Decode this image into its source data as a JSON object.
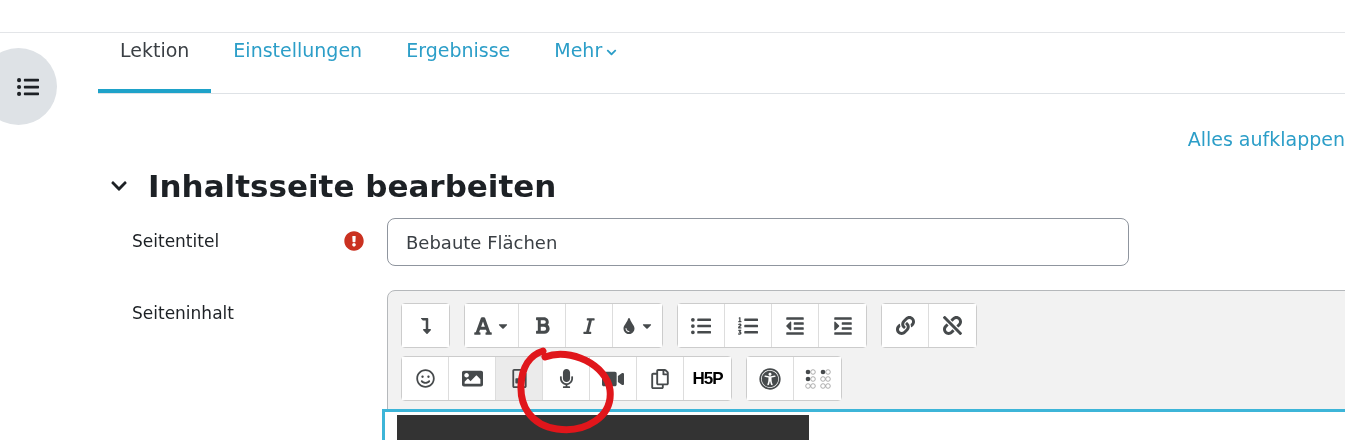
{
  "tabs": [
    {
      "label": "Lektion",
      "selected": true
    },
    {
      "label": "Einstellungen",
      "selected": false
    },
    {
      "label": "Ergebnisse",
      "selected": false
    },
    {
      "label": "Mehr",
      "selected": false,
      "dropdown": true
    }
  ],
  "expand_all": "Alles aufklappen",
  "section": {
    "title": "Inhaltsseite bearbeiten",
    "expanded": true
  },
  "fields": [
    {
      "label": "Seitentitel",
      "required": true,
      "value": "Bebaute Flächen"
    },
    {
      "label": "Seiteninhalt",
      "required": false
    }
  ],
  "toolbar_rows": [
    [
      [
        {
          "kind": "collapse",
          "selected": false
        }
      ],
      [
        {
          "kind": "font",
          "selected": false
        },
        {
          "kind": "bold",
          "selected": false
        },
        {
          "kind": "italic",
          "selected": false
        },
        {
          "kind": "color",
          "selected": false
        }
      ],
      [
        {
          "kind": "bullets",
          "selected": false
        },
        {
          "kind": "numbers",
          "selected": false
        },
        {
          "kind": "outdent",
          "selected": false
        },
        {
          "kind": "indent",
          "selected": false
        }
      ],
      [
        {
          "kind": "link",
          "selected": false
        },
        {
          "kind": "unlink",
          "selected": false
        }
      ]
    ],
    [
      [
        {
          "kind": "emoji",
          "selected": false
        },
        {
          "kind": "image",
          "selected": false
        },
        {
          "kind": "media",
          "selected": true
        },
        {
          "kind": "audio",
          "selected": false
        },
        {
          "kind": "video",
          "selected": false
        },
        {
          "kind": "copy",
          "selected": false
        },
        {
          "kind": "h5p",
          "label": "H5P",
          "selected": false
        }
      ],
      [
        {
          "kind": "accessibility",
          "selected": false
        },
        {
          "kind": "braille",
          "selected": false
        }
      ]
    ]
  ],
  "annotation": {
    "kind": "circle"
  }
}
